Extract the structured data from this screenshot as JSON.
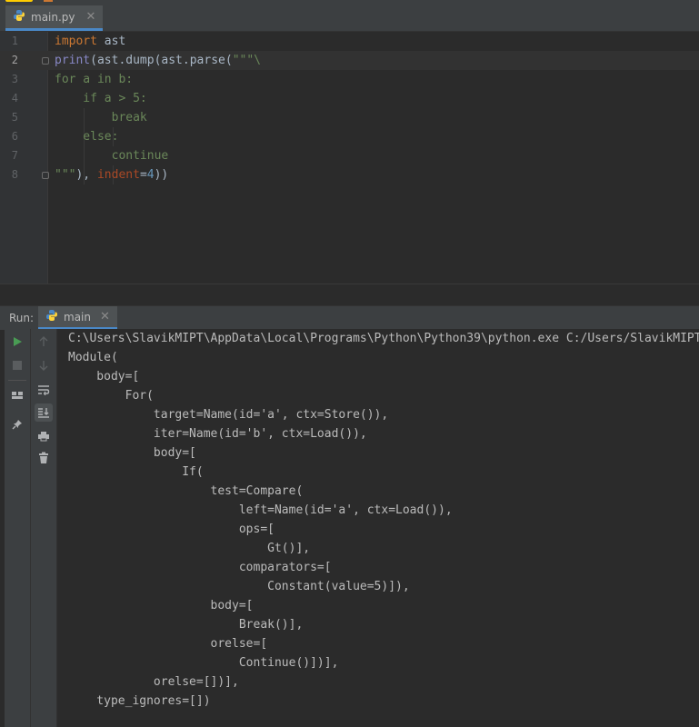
{
  "editor": {
    "tab_label": "main.py",
    "tab_close": "✕",
    "lines": [
      {
        "n": "1"
      },
      {
        "n": "2"
      },
      {
        "n": "3"
      },
      {
        "n": "4"
      },
      {
        "n": "5"
      },
      {
        "n": "6"
      },
      {
        "n": "7"
      },
      {
        "n": "8"
      }
    ],
    "code": {
      "l1_kw": "import",
      "l1_rest": " ast",
      "l2_fn": "print",
      "l2_rest": "(ast.dump(ast.parse(",
      "l2_str": "\"\"\"\\",
      "l3": "for a in b:",
      "l4": "    if a > 5:",
      "l5": "        break",
      "l6": "    else:",
      "l7": "        continue",
      "l8_str": "\"\"\"",
      "l8_a": "), ",
      "l8_param": "indent",
      "l8_b": "=",
      "l8_num": "4",
      "l8_c": "))"
    }
  },
  "run_panel": {
    "label": "Run:",
    "tab_label": "main",
    "tab_close": "✕"
  },
  "console": {
    "lines": [
      "C:\\Users\\SlavikMIPT\\AppData\\Local\\Programs\\Python\\Python39\\python.exe C:/Users/SlavikMIPT",
      "Module(",
      "    body=[",
      "        For(",
      "            target=Name(id='a', ctx=Store()),",
      "            iter=Name(id='b', ctx=Load()),",
      "            body=[",
      "                If(",
      "                    test=Compare(",
      "                        left=Name(id='a', ctx=Load()),",
      "                        ops=[",
      "                            Gt()],",
      "                        comparators=[",
      "                            Constant(value=5)]),",
      "                    body=[",
      "                        Break()],",
      "                    orelse=[",
      "                        Continue()])],",
      "            orelse=[])],",
      "    type_ignores=[])"
    ]
  },
  "colors": {
    "keyword": "#cc7832",
    "builtin": "#8888c6",
    "string": "#6a8759",
    "number": "#6897bb",
    "run_green": "#499c54"
  }
}
